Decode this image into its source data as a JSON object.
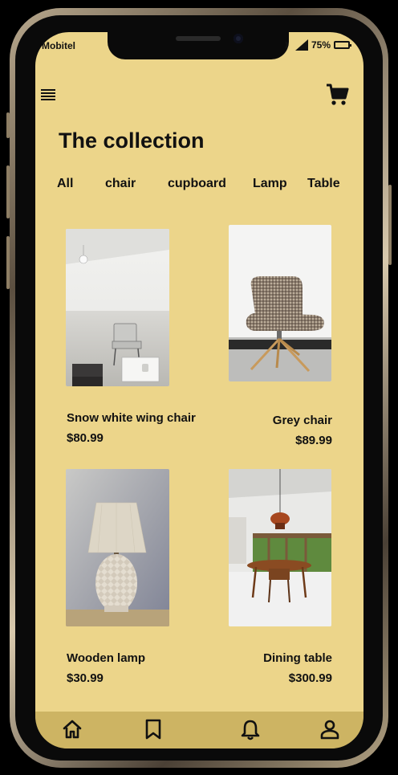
{
  "status_bar": {
    "carrier": "Mobitel",
    "battery": "75%"
  },
  "header": {
    "menu_icon": "hamburger-menu-icon",
    "cart_icon": "shopping-cart-icon"
  },
  "page": {
    "title": "The collection"
  },
  "tabs": [
    {
      "label": "All"
    },
    {
      "label": "chair"
    },
    {
      "label": "cupboard"
    },
    {
      "label": "Lamp"
    },
    {
      "label": "Table"
    }
  ],
  "products": [
    {
      "name": "Snow white wing chair",
      "price": "$80.99"
    },
    {
      "name": "Grey chair",
      "price": "$89.99"
    },
    {
      "name": "Wooden lamp",
      "price": "$30.99"
    },
    {
      "name": "Dining table",
      "price": "$300.99"
    }
  ],
  "bottom_nav": [
    {
      "icon": "home-icon"
    },
    {
      "icon": "bookmark-icon"
    },
    {
      "icon": "bell-icon"
    },
    {
      "icon": "user-icon"
    }
  ],
  "colors": {
    "background": "#ecd58a",
    "bottom_bar": "#cdb463",
    "text": "#111111"
  }
}
